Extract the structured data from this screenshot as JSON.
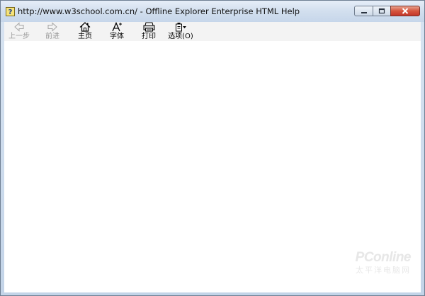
{
  "window": {
    "title": "http://www.w3school.com.cn/ - Offline Explorer Enterprise HTML Help"
  },
  "toolbar": {
    "buttons": [
      {
        "label": "上一步",
        "icon": "back-arrow-icon",
        "enabled": false
      },
      {
        "label": "前进",
        "icon": "forward-arrow-icon",
        "enabled": false
      },
      {
        "label": "主页",
        "icon": "home-icon",
        "enabled": true
      },
      {
        "label": "字体",
        "icon": "font-icon",
        "enabled": true
      },
      {
        "label": "打印",
        "icon": "printer-icon",
        "enabled": true
      },
      {
        "label": "选项(O)",
        "icon": "options-icon",
        "enabled": true
      }
    ]
  },
  "watermark": {
    "logo_text": "PConline",
    "subtext": "太平洋电脑网"
  },
  "colors": {
    "titlebar": "#d2dfee",
    "toolbar": "#f3f3f3",
    "content": "#ffffff",
    "close_button": "#c4372a"
  }
}
